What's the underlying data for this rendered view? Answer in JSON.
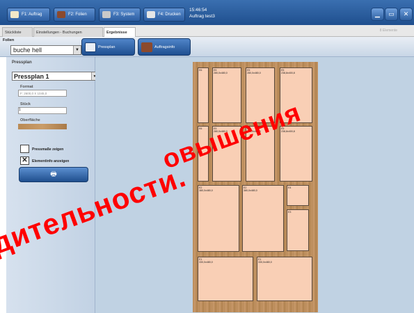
{
  "topbar": {
    "buttons": [
      {
        "label": "F1: Auftrag",
        "icon": "folder-icon",
        "color": "#f2e8c8"
      },
      {
        "label": "F2: Folien",
        "icon": "sheets-icon",
        "color": "#8b4a2e"
      },
      {
        "label": "F3: System",
        "icon": "tools-icon",
        "color": "#c9c9c9"
      },
      {
        "label": "F4: Drucken",
        "icon": "printer-icon",
        "color": "#e6e6e6"
      }
    ],
    "time": "15:46:54",
    "order": "Auftrag test3"
  },
  "tabs": [
    "Stückliste",
    "Einstellungen - Buchungen",
    "Ergebnisse"
  ],
  "element_count": "8 Elemente",
  "toolbar": {
    "folien_label": "Folien",
    "folien_value": "buche hell",
    "pressplan_btn": "Pressplan",
    "auftragsinfo_btn": "Auftragsinfo"
  },
  "left": {
    "pressplan_label": "Pressplan",
    "pressplan_value": "Pressplan 1",
    "format_label": "Format",
    "format_value": "F: 2600,0 X 1045,0",
    "stueck_label": "Stück",
    "stueck_value": "1",
    "oberflaeche_label": "Oberfläche",
    "chk_pressmasse": "Pressmaße zeigen",
    "chk_pressmasse_checked": false,
    "chk_elementinfo": "Elementinfo anzeigen",
    "chk_elementinfo_checked": true,
    "print_icon": "printer-icon"
  },
  "pieces": [
    {
      "id": "E6",
      "dim": ""
    },
    {
      "id": "E5",
      "dim": "280,0x480,0"
    },
    {
      "id": "E5",
      "dim": "280,0x480,0"
    },
    {
      "id": "E5",
      "dim": "238,8x400,8"
    },
    {
      "id": "E6",
      "dim": ""
    },
    {
      "id": "E5",
      "dim": "280,0x480,0"
    },
    {
      "id": "E5",
      "dim": "280,0x480,0"
    },
    {
      "id": "E5",
      "dim": "238,8x400,8"
    },
    {
      "id": "E2",
      "dim": "380,0x480,0"
    },
    {
      "id": "E2",
      "dim": "380,0x480,0"
    },
    {
      "id": "E4",
      "dim": ""
    },
    {
      "id": "E3",
      "dim": ""
    },
    {
      "id": "E1",
      "dim": "330,0x480,0"
    },
    {
      "id": "E1",
      "dim": "330,0x480,0"
    }
  ],
  "watermark": {
    "line1": "овышения",
    "line2": "дительности.",
    "color": "#ff0000"
  }
}
